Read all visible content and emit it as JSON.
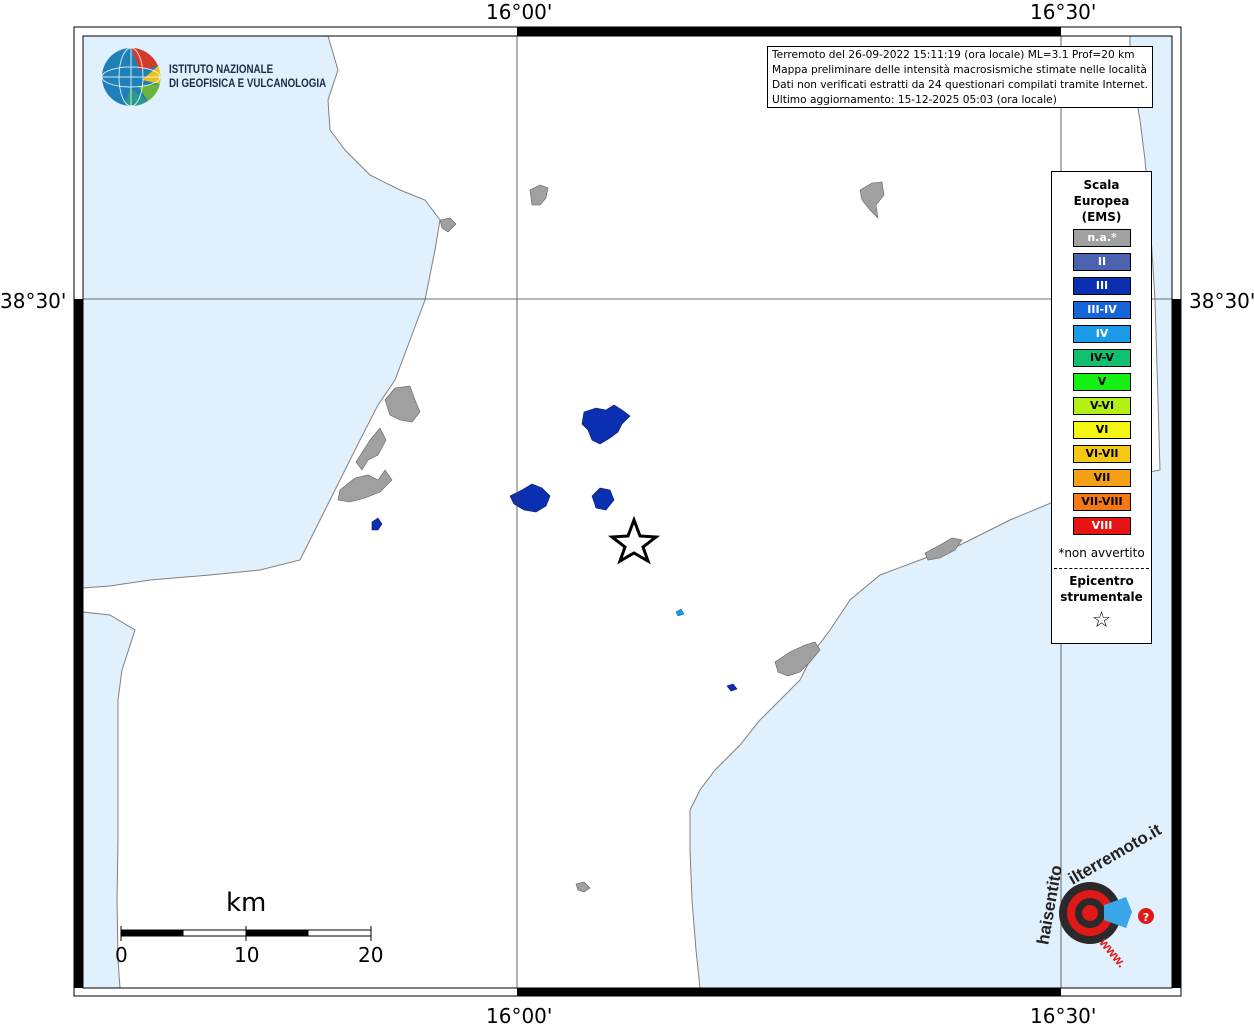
{
  "axes": {
    "top_left_lon": "16°00'",
    "top_right_lon": "16°30'",
    "bottom_left_lon": "16°00'",
    "bottom_right_lon": "16°30'",
    "left_lat": "38°30'",
    "right_lat": "38°30'"
  },
  "institute": {
    "line1": "ISTITUTO NAZIONALE",
    "line2": "DI GEOFISICA E VULCANOLOGIA"
  },
  "info": {
    "line1": "Terremoto del 26-09-2022 15:11:19 (ora locale) ML=3.1 Prof=20 km",
    "line2": "Mappa preliminare delle intensità macrosismiche stimate nelle località",
    "line3": "Dati non verificati estratti da 24 questionari compilati tramite Internet.",
    "line4": "Ultimo aggiornamento: 15-12-2025 05:03 (ora locale)"
  },
  "legend": {
    "title1": "Scala",
    "title2": "Europea",
    "title3": "(EMS)",
    "items": [
      {
        "label": "n.a.*",
        "color": "#a0a0a0",
        "text_color": "#ffffff"
      },
      {
        "label": "II",
        "color": "#4a62b0",
        "text_color": "#ffffff"
      },
      {
        "label": "III",
        "color": "#0a2fb0",
        "text_color": "#ffffff"
      },
      {
        "label": "III-IV",
        "color": "#1565d8",
        "text_color": "#ffffff"
      },
      {
        "label": "IV",
        "color": "#1a9be8",
        "text_color": "#ffffff"
      },
      {
        "label": "IV-V",
        "color": "#10c070",
        "text_color": "#000000"
      },
      {
        "label": "V",
        "color": "#14f014",
        "text_color": "#000000"
      },
      {
        "label": "V-VI",
        "color": "#b4f014",
        "text_color": "#000000"
      },
      {
        "label": "VI",
        "color": "#f5f514",
        "text_color": "#000000"
      },
      {
        "label": "VI-VII",
        "color": "#f5c814",
        "text_color": "#000000"
      },
      {
        "label": "VII",
        "color": "#f5a014",
        "text_color": "#000000"
      },
      {
        "label": "VII-VIII",
        "color": "#f57814",
        "text_color": "#000000"
      },
      {
        "label": "VIII",
        "color": "#e81414",
        "text_color": "#ffffff"
      }
    ],
    "note": "*non avvertito",
    "epicentre1": "Epicentro",
    "epicentre2": "strumentale",
    "epicentre_symbol": "☆"
  },
  "scale_bar": {
    "unit": "km",
    "labels": [
      "0",
      "10",
      "20"
    ]
  },
  "watermark": {
    "line1": "haisentito",
    "line2": "ilterremoto.it",
    "url": "www."
  },
  "colors": {
    "sea": "#e0f0fc",
    "land": "#ffffff",
    "coast": "#808080",
    "town_na": "#a0a0a0",
    "int_III": "#0a2fb0",
    "int_IV": "#1a9be8"
  }
}
